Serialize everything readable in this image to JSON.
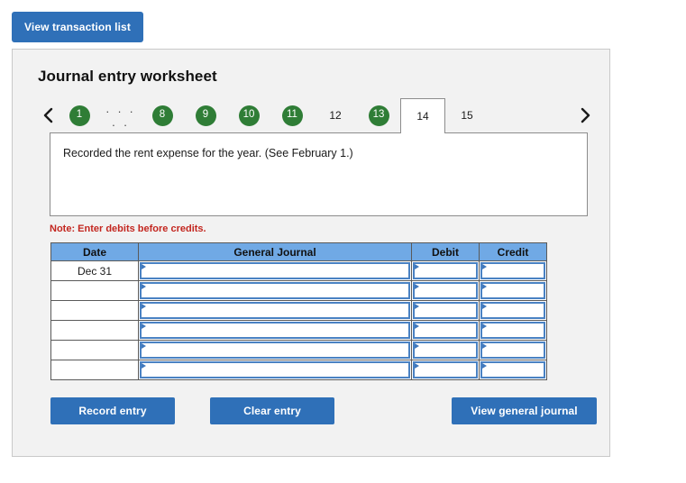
{
  "top": {
    "view_transaction_list_label": "View transaction list"
  },
  "panel": {
    "title": "Journal entry worksheet",
    "prev_icon": "chevron-left-icon",
    "next_icon": "chevron-right-icon",
    "ellipsis": ". . . . .",
    "tabs": [
      {
        "label": "1",
        "state": "completed",
        "selected": false
      },
      {
        "label": "8",
        "state": "completed",
        "selected": false
      },
      {
        "label": "9",
        "state": "completed",
        "selected": false
      },
      {
        "label": "10",
        "state": "completed",
        "selected": false
      },
      {
        "label": "11",
        "state": "completed",
        "selected": false
      },
      {
        "label": "12",
        "state": "plain",
        "selected": false
      },
      {
        "label": "13",
        "state": "completed",
        "selected": false
      },
      {
        "label": "14",
        "state": "plain",
        "selected": true
      },
      {
        "label": "15",
        "state": "plain",
        "selected": false
      }
    ],
    "transaction_text": "Recorded the rent expense for the year. (See February 1.)",
    "note": "Note: Enter debits before credits."
  },
  "journal": {
    "headers": {
      "date": "Date",
      "general_journal": "General Journal",
      "debit": "Debit",
      "credit": "Credit"
    },
    "rows": [
      {
        "date": "Dec 31",
        "account": "",
        "debit": "",
        "credit": ""
      },
      {
        "date": "",
        "account": "",
        "debit": "",
        "credit": ""
      },
      {
        "date": "",
        "account": "",
        "debit": "",
        "credit": ""
      },
      {
        "date": "",
        "account": "",
        "debit": "",
        "credit": ""
      },
      {
        "date": "",
        "account": "",
        "debit": "",
        "credit": ""
      },
      {
        "date": "",
        "account": "",
        "debit": "",
        "credit": ""
      }
    ]
  },
  "actions": {
    "record_entry_label": "Record entry",
    "clear_entry_label": "Clear entry",
    "view_general_journal_label": "View general journal"
  },
  "colors": {
    "button_blue": "#2f70b8",
    "table_header_blue": "#70a9e5",
    "completed_tab_green": "#2f7d36",
    "note_red": "#c3261f",
    "panel_bg": "#f2f2f2"
  }
}
